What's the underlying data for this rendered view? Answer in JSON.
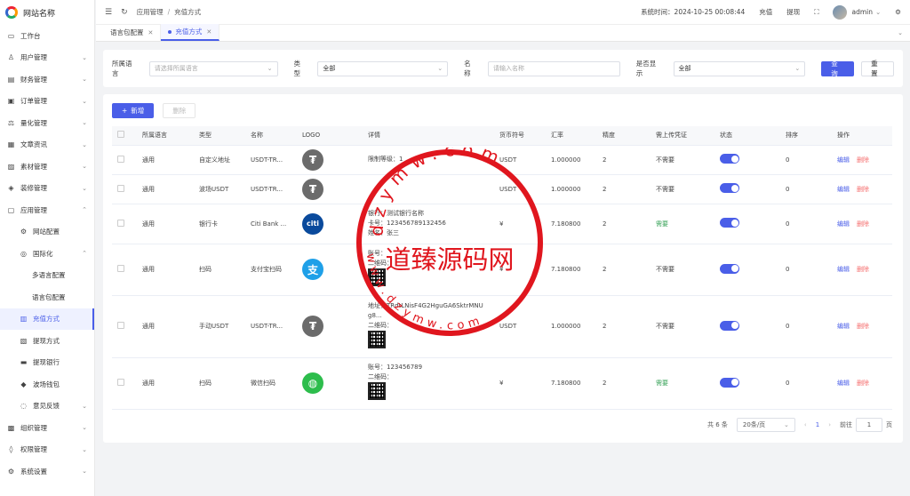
{
  "app": {
    "name": "网站名称"
  },
  "sidebar": {
    "items": [
      {
        "label": "工作台",
        "icon": "monitor-icon"
      },
      {
        "label": "用户管理",
        "icon": "user-icon",
        "arrow": "⌄"
      },
      {
        "label": "财务管理",
        "icon": "chart-icon",
        "arrow": "⌄"
      },
      {
        "label": "订单管理",
        "icon": "order-icon",
        "arrow": "⌄"
      },
      {
        "label": "量化管理",
        "icon": "quant-icon",
        "arrow": "⌄"
      },
      {
        "label": "文章资讯",
        "icon": "article-icon",
        "arrow": "⌄"
      },
      {
        "label": "素材管理",
        "icon": "image-icon",
        "arrow": "⌄"
      },
      {
        "label": "装修管理",
        "icon": "decor-icon",
        "arrow": "⌄"
      },
      {
        "label": "应用管理",
        "icon": "app-icon",
        "arrow": "⌃"
      },
      {
        "label": "网站配置",
        "icon": "gear-icon",
        "level": 1
      },
      {
        "label": "国际化",
        "icon": "globe-icon",
        "level": 1,
        "arrow": "⌃"
      },
      {
        "label": "多语言配置",
        "level": 2
      },
      {
        "label": "语言包配置",
        "level": 2
      },
      {
        "label": "充值方式",
        "icon": "recharge-icon",
        "level": 1,
        "active": true
      },
      {
        "label": "提现方式",
        "icon": "withdraw-icon",
        "level": 1
      },
      {
        "label": "提现银行",
        "icon": "bank-icon",
        "level": 1
      },
      {
        "label": "波场钱包",
        "icon": "wallet-icon",
        "level": 1
      },
      {
        "label": "意见反馈",
        "icon": "feedback-icon",
        "level": 1,
        "arrow": "⌄"
      },
      {
        "label": "组织管理",
        "icon": "org-icon",
        "arrow": "⌄"
      },
      {
        "label": "权限管理",
        "icon": "shield-icon",
        "arrow": "⌄"
      },
      {
        "label": "系统设置",
        "icon": "settings-icon",
        "arrow": "⌄"
      }
    ]
  },
  "header": {
    "breadcrumb": [
      "应用管理",
      "充值方式"
    ],
    "system_time": "系统时间：2024-10-25 00:08:44",
    "recharge": "充值",
    "withdraw": "提现",
    "user": "admin"
  },
  "tabs": [
    {
      "label": "语言包配置",
      "active": false
    },
    {
      "label": "充值方式",
      "active": true
    }
  ],
  "filter": {
    "lang_label": "所属语言",
    "lang_placeholder": "请选择所属语言",
    "type_label": "类型",
    "type_value": "全部",
    "name_label": "名称",
    "name_placeholder": "请输入名称",
    "show_label": "是否显示",
    "show_value": "全部",
    "search": "查询",
    "reset": "重置"
  },
  "toolbar": {
    "add": "新增",
    "delete": "删除"
  },
  "table": {
    "columns": [
      "所属语言",
      "类型",
      "名称",
      "LOGO",
      "详情",
      "货币符号",
      "汇率",
      "精度",
      "需上传凭证",
      "状态",
      "排序",
      "操作"
    ],
    "rows": [
      {
        "lang": "通用",
        "type": "自定义地址",
        "name": "USDT-TR...",
        "logo": "tether",
        "detail": [
          "限制等级：1"
        ],
        "qr": false,
        "currency": "USDT",
        "rate": "1.000000",
        "precision": "2",
        "voucher": "不需要",
        "voucher_needed": false,
        "sort": "0"
      },
      {
        "lang": "通用",
        "type": "波场USDT",
        "name": "USDT-TR...",
        "logo": "tether",
        "detail": [],
        "qr": false,
        "currency": "USDT",
        "rate": "1.000000",
        "precision": "2",
        "voucher": "不需要",
        "voucher_needed": false,
        "sort": "0"
      },
      {
        "lang": "通用",
        "type": "银行卡",
        "name": "Citi Bank ...",
        "logo": "citi",
        "detail": [
          "银行：测试银行名称",
          "卡号：123456789132456",
          "姓名：张三"
        ],
        "qr": false,
        "currency": "¥",
        "rate": "7.180800",
        "precision": "2",
        "voucher": "需要",
        "voucher_needed": true,
        "sort": "0"
      },
      {
        "lang": "通用",
        "type": "扫码",
        "name": "支付宝扫码",
        "logo": "alipay",
        "detail": [
          "账号：",
          "二维码："
        ],
        "qr": true,
        "currency": "¥",
        "rate": "7.180800",
        "precision": "2",
        "voucher": "不需要",
        "voucher_needed": false,
        "sort": "0"
      },
      {
        "lang": "通用",
        "type": "手动USDT",
        "name": "USDT-TR...",
        "logo": "tether",
        "detail": [
          "地址：TRdtLNisF4G2HguGA6SktrMNU",
          "g8...",
          "二维码："
        ],
        "qr": true,
        "currency": "USDT",
        "rate": "1.000000",
        "precision": "2",
        "voucher": "不需要",
        "voucher_needed": false,
        "sort": "0"
      },
      {
        "lang": "通用",
        "type": "扫码",
        "name": "微信扫码",
        "logo": "wechat",
        "detail": [
          "账号：123456789",
          "二维码："
        ],
        "qr": true,
        "currency": "¥",
        "rate": "7.180800",
        "precision": "2",
        "voucher": "需要",
        "voucher_needed": true,
        "sort": "0"
      }
    ],
    "edit": "编辑",
    "del": "删除"
  },
  "pager": {
    "total": "共 6 条",
    "size": "20条/页",
    "page": "1",
    "goto": "前往",
    "goto_value": "1",
    "page_suffix": "页"
  },
  "watermark": {
    "text": "道臻源码网",
    "url_top": "dzymw.com",
    "url_bottom": "www.dzymw.com"
  },
  "colors": {
    "accent": "#4a5ee8",
    "danger": "#f56c6c",
    "success": "#3aa35a",
    "stamp": "#e0161e"
  }
}
